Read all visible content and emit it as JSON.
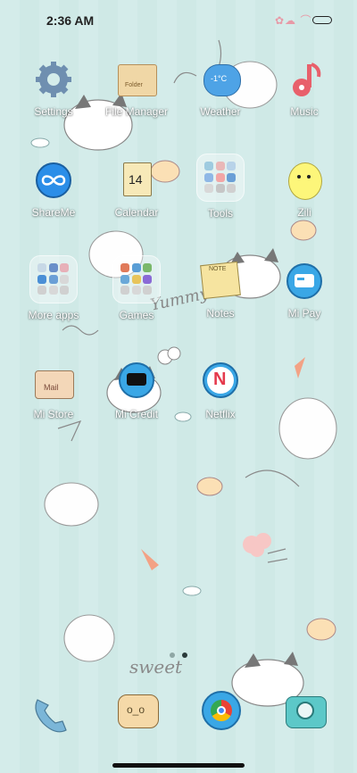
{
  "status_bar": {
    "time": "2:36 AM"
  },
  "apps": [
    {
      "id": "settings",
      "label": "Settings"
    },
    {
      "id": "file-manager",
      "label": "File Manager",
      "badge_text": "Folder"
    },
    {
      "id": "weather",
      "label": "Weather",
      "temp": "-1°C"
    },
    {
      "id": "music",
      "label": "Music"
    },
    {
      "id": "shareme",
      "label": "ShareMe"
    },
    {
      "id": "calendar",
      "label": "Calendar",
      "day": "14"
    },
    {
      "id": "tools",
      "label": "Tools"
    },
    {
      "id": "zili",
      "label": "Zili"
    },
    {
      "id": "more-apps",
      "label": "More apps"
    },
    {
      "id": "games",
      "label": "Games"
    },
    {
      "id": "notes",
      "label": "Notes",
      "badge_text": "NOTE"
    },
    {
      "id": "mi-pay",
      "label": "Mi Pay"
    },
    {
      "id": "mi-store",
      "label": "Mi Store",
      "badge_text": "Mail"
    },
    {
      "id": "mi-credit",
      "label": "Mi Credit"
    },
    {
      "id": "netflix",
      "label": "Netflix",
      "glyph": "N"
    }
  ],
  "doodle_text": {
    "yummy": "Yummy",
    "sweet": "sweet"
  },
  "dock": [
    {
      "id": "phone",
      "icon": "phone-icon"
    },
    {
      "id": "messages",
      "icon": "messages-icon",
      "glyph": "o_o"
    },
    {
      "id": "chrome",
      "icon": "chrome-icon"
    },
    {
      "id": "camera",
      "icon": "camera-icon"
    }
  ],
  "page_indicator": {
    "pages": 2,
    "active": 1
  },
  "colors": {
    "accent_blue": "#3aa7e6",
    "netflix_red": "#e53a4d",
    "pink": "#e79aa7"
  }
}
